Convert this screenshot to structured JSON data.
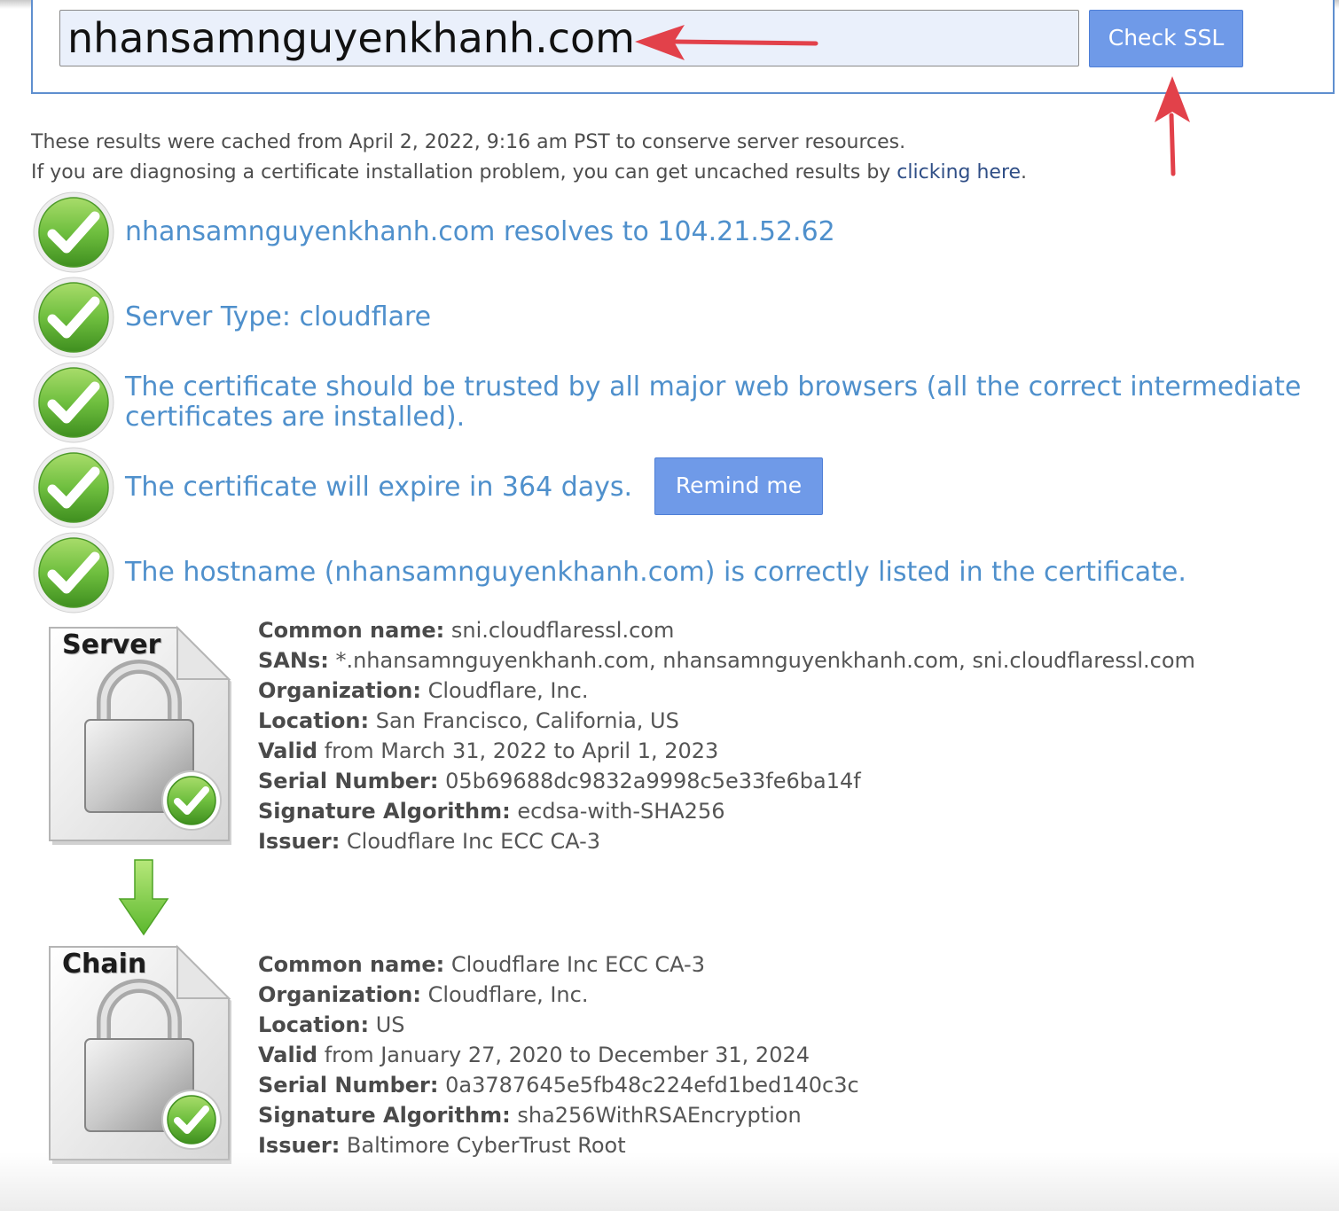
{
  "search": {
    "value": "nhansamnguyenkhanh.com",
    "button_label": "Check SSL"
  },
  "cache_notice": {
    "line1": "These results were cached from April 2, 2022, 9:16 am PST to conserve server resources.",
    "line2_prefix": "If you are diagnosing a certificate installation problem, you can get uncached results by ",
    "link_text": "clicking here",
    "line2_suffix": "."
  },
  "results": [
    "nhansamnguyenkhanh.com resolves to 104.21.52.62",
    "Server Type: cloudflare",
    "The certificate should be trusted by all major web browsers (all the correct intermediate",
    "certificates are installed).",
    "The certificate will expire in 364 days.",
    "The hostname (nhansamnguyenkhanh.com) is correctly listed in the certificate."
  ],
  "remind_button_label": "Remind me",
  "certificates": {
    "server": {
      "label": "Server",
      "fields": [
        {
          "key": "Common name:",
          "value": " sni.cloudflaressl.com"
        },
        {
          "key": "SANs:",
          "value": " *.nhansamnguyenkhanh.com, nhansamnguyenkhanh.com, sni.cloudflaressl.com"
        },
        {
          "key": "Organization:",
          "value": " Cloudflare, Inc."
        },
        {
          "key": "Location:",
          "value": " San Francisco, California, US"
        },
        {
          "key": "Valid",
          "value": " from March 31, 2022 to April 1, 2023"
        },
        {
          "key": "Serial Number:",
          "value": " 05b69688dc9832a9998c5e33fe6ba14f"
        },
        {
          "key": "Signature Algorithm:",
          "value": " ecdsa-with-SHA256"
        },
        {
          "key": "Issuer:",
          "value": " Cloudflare Inc ECC CA-3"
        }
      ]
    },
    "chain": {
      "label": "Chain",
      "fields": [
        {
          "key": "Common name:",
          "value": " Cloudflare Inc ECC CA-3"
        },
        {
          "key": "Organization:",
          "value": " Cloudflare, Inc."
        },
        {
          "key": "Location:",
          "value": " US"
        },
        {
          "key": "Valid",
          "value": " from January 27, 2020 to December 31, 2024"
        },
        {
          "key": "Serial Number:",
          "value": " 0a3787645e5fb48c224efd1bed140c3c"
        },
        {
          "key": "Signature Algorithm:",
          "value": " sha256WithRSAEncryption"
        },
        {
          "key": "Issuer:",
          "value": " Baltimore CyberTrust Root"
        }
      ]
    }
  },
  "colors": {
    "accent_blue": "#4f90cc",
    "button_blue": "#6f9ae8",
    "check_green": "#6fbf3f",
    "annotation_red": "#e2414a"
  },
  "icons": [
    "check-circle-icon",
    "certificate-lock-icon",
    "down-arrow-icon",
    "annotation-arrow-icon"
  ]
}
